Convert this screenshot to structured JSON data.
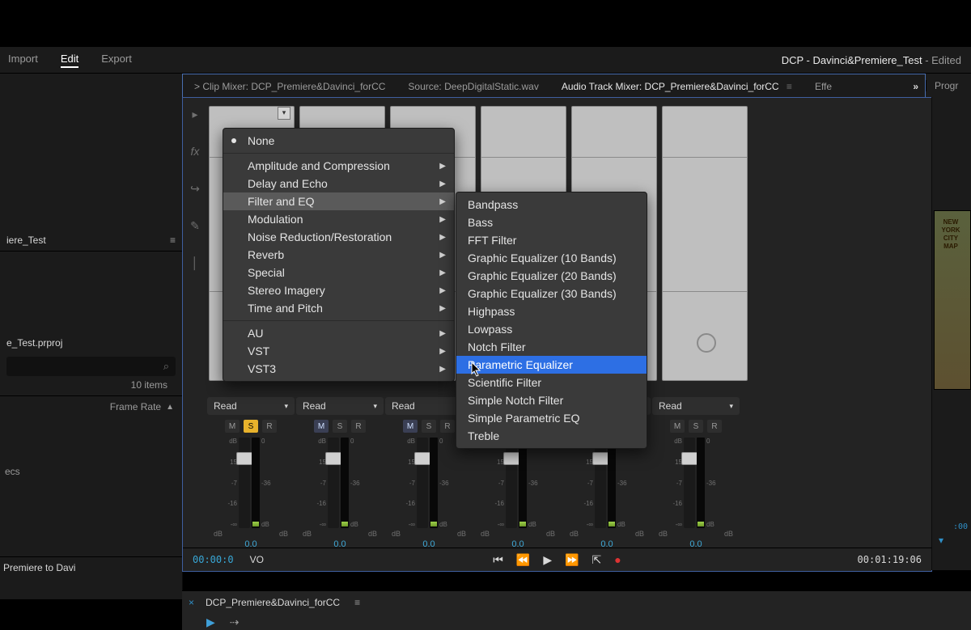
{
  "menubar": {
    "items": [
      "Import",
      "Edit",
      "Export"
    ],
    "active": 1,
    "project": "DCP - Davinci&Premiere_Test",
    "suffix": " - Edited"
  },
  "tabbar": {
    "tabs": [
      {
        "label": "Clip Mixer: DCP_Premiere&Davinci_forCC",
        "prefix": "> "
      },
      {
        "label": "Source: DeepDigitalStatic.wav"
      },
      {
        "label": "Audio Track Mixer: DCP_Premiere&Davinci_forCC",
        "active": true,
        "menu": true
      },
      {
        "label": "Effe"
      }
    ],
    "chev": "»",
    "progr": "Progr"
  },
  "left": {
    "project_suffix": "iere_Test",
    "proj_name": "e_Test.prproj",
    "items_count": "10 items",
    "frame_label": "Frame Rate",
    "ecs": "ecs",
    "bottom": "Premiere to Davi"
  },
  "mixer": {
    "read": "Read",
    "scaleL": [
      "dB",
      "15",
      "-7",
      "-16",
      "-∞"
    ],
    "scaleR": [
      "0",
      "-36",
      "dB"
    ],
    "dB": "dB",
    "chan_val": "0.0",
    "tc_left": "00:00:0",
    "tc_label": "VO",
    "tc_right": "00:01:19:06",
    "channels": [
      {
        "m": false,
        "s": true,
        "r": false
      },
      {
        "m": true,
        "s": false,
        "r": false
      },
      {
        "m": true,
        "s": false,
        "r": false
      },
      {
        "m": false,
        "s": false,
        "r": false
      },
      {
        "m": false,
        "s": false,
        "r": false
      },
      {
        "m": false,
        "s": false,
        "r": false
      }
    ]
  },
  "rstrip": {
    "map": "NEW YORK CITY MAP",
    "tc": ":00"
  },
  "timeline": {
    "name": "DCP_Premiere&Davinci_forCC"
  },
  "context_main": {
    "none": "None",
    "items": [
      "Amplitude and Compression",
      "Delay and Echo",
      "Filter and EQ",
      "Modulation",
      "Noise Reduction/Restoration",
      "Reverb",
      "Special",
      "Stereo Imagery",
      "Time and Pitch"
    ],
    "highlight": 2,
    "plugins": [
      "AU",
      "VST",
      "VST3"
    ]
  },
  "context_sub": {
    "items": [
      "Bandpass",
      "Bass",
      "FFT Filter",
      "Graphic Equalizer (10 Bands)",
      "Graphic Equalizer (20 Bands)",
      "Graphic Equalizer (30 Bands)",
      "Highpass",
      "Lowpass",
      "Notch Filter",
      "Parametric Equalizer",
      "Scientific Filter",
      "Simple Notch Filter",
      "Simple Parametric EQ",
      "Treble"
    ],
    "selected": 9
  }
}
